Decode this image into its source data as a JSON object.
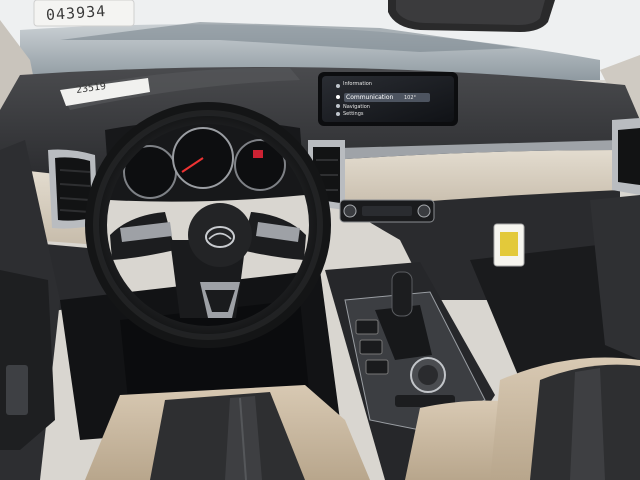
{
  "scene": {
    "description_label": "",
    "windshield_sticker": "043934",
    "dash_sticker": "23519",
    "infotainment": {
      "menu": [
        "Information",
        "Communication",
        "Navigation",
        "Settings"
      ],
      "selected": "Communication",
      "temperature": "102°"
    },
    "steering_logo": "mazda-logo"
  },
  "colors": {
    "dash_dark": "#2b2c2e",
    "dash_upper": "#3a3b3d",
    "trim_beige": "#d4cbbd",
    "seat_beige": "#c9b8a0",
    "seat_fabric": "#2e2f31",
    "chrome": "#b9bcc0",
    "windshield": "#aeb7bd",
    "sky": "#e9ecee"
  }
}
